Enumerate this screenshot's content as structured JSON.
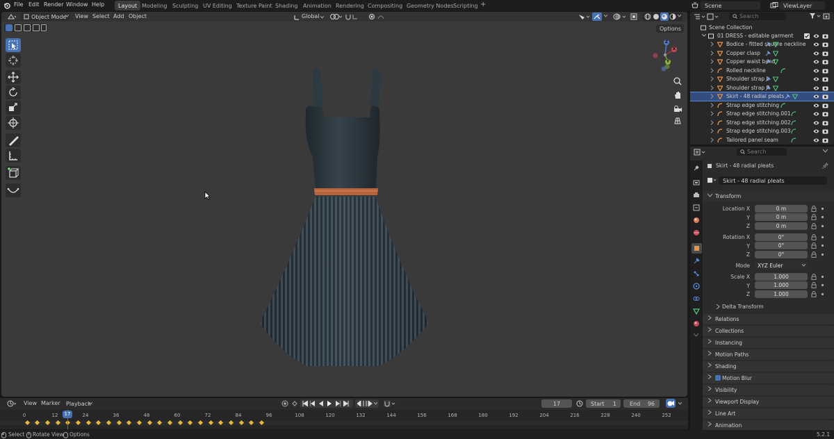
{
  "menu": {
    "file": "File",
    "edit": "Edit",
    "render": "Render",
    "window": "Window",
    "help": "Help"
  },
  "workspaces": [
    "Layout",
    "Modeling",
    "Sculpting",
    "UV Editing",
    "Texture Paint",
    "Shading",
    "Animation",
    "Rendering",
    "Compositing",
    "Geometry Nodes",
    "Scripting"
  ],
  "workspace_add": "+",
  "scene": {
    "name": "Scene",
    "view_layer": "ViewLayer"
  },
  "viewport": {
    "mode": "Object Mode",
    "view": "View",
    "select": "Select",
    "add": "Add",
    "object": "Object",
    "orientation": "Global",
    "options": "Options",
    "gizmo": {
      "x": "X",
      "y": "Y",
      "z": "Z"
    }
  },
  "outliner": {
    "search_placeholder": "Search",
    "root": "Scene Collection",
    "collection": "01 DRESS - editable garment",
    "items": [
      {
        "label": "Bodice - fitted square neckline",
        "type": "mesh"
      },
      {
        "label": "Copper clasp",
        "type": "mesh"
      },
      {
        "label": "Copper waist band",
        "type": "mesh"
      },
      {
        "label": "Rolled neckline",
        "type": "curve"
      },
      {
        "label": "Shoulder strap L",
        "type": "mesh"
      },
      {
        "label": "Shoulder strap R",
        "type": "mesh"
      },
      {
        "label": "Skirt - 48 radial pleats",
        "type": "mesh",
        "selected": true
      },
      {
        "label": "Strap edge stitching",
        "type": "curve"
      },
      {
        "label": "Strap edge stitching.001",
        "type": "curve"
      },
      {
        "label": "Strap edge stitching.002",
        "type": "curve"
      },
      {
        "label": "Strap edge stitching.003",
        "type": "curve"
      },
      {
        "label": "Tailored panel seam",
        "type": "curve"
      }
    ]
  },
  "properties": {
    "search_placeholder": "Search",
    "object_name": "Skirt - 48 radial pleats",
    "object_field": "Skirt - 48 radial pleats",
    "transform": {
      "title": "Transform",
      "location_label": "Location X",
      "y_label": "Y",
      "z_label": "Z",
      "location": [
        "0 m",
        "0 m",
        "0 m"
      ],
      "rotation_label": "Rotation X",
      "rotation": [
        "0°",
        "0°",
        "0°"
      ],
      "mode_label": "Mode",
      "mode": "XYZ Euler",
      "scale_label": "Scale X",
      "scale": [
        "1.000",
        "1.000",
        "1.000"
      ],
      "delta": "Delta Transform"
    },
    "panels": [
      "Relations",
      "Collections",
      "Instancing",
      "Motion Paths",
      "Shading",
      "Motion Blur",
      "Visibility",
      "Viewport Display",
      "Line Art",
      "Animation"
    ]
  },
  "timeline": {
    "view": "View",
    "marker": "Marker",
    "playback": "Playback",
    "current_frame": "17",
    "start_label": "Start",
    "start": "1",
    "end_label": "End",
    "end": "96",
    "ticks": [
      "0",
      "12",
      "24",
      "36",
      "48",
      "60",
      "72",
      "84",
      "96",
      "108",
      "120",
      "132",
      "144",
      "156",
      "168",
      "180",
      "192",
      "204",
      "216",
      "228",
      "240",
      "252"
    ]
  },
  "status": {
    "select": "Select",
    "rotate": "Rotate View",
    "options": "Options",
    "version": "5.2.1"
  },
  "colors": {
    "accent": "#4772b3",
    "keyframe": "#e8b73a",
    "selection": "#334d80"
  }
}
